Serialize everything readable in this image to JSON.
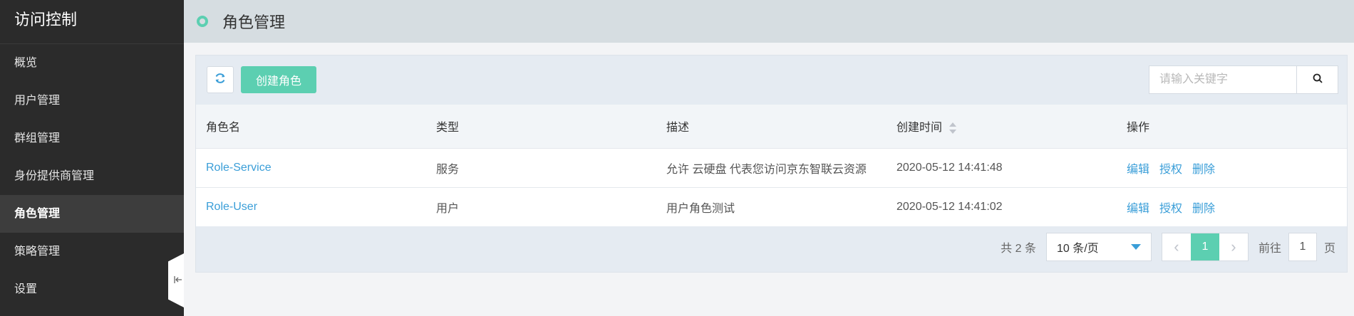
{
  "app": {
    "title": "访问控制"
  },
  "sidebar": {
    "items": [
      {
        "label": "概览"
      },
      {
        "label": "用户管理"
      },
      {
        "label": "群组管理"
      },
      {
        "label": "身份提供商管理"
      },
      {
        "label": "角色管理",
        "active": true
      },
      {
        "label": "策略管理"
      },
      {
        "label": "设置"
      }
    ],
    "collapse_icon": "collapse-left-icon"
  },
  "header": {
    "title": "角色管理",
    "accent_color": "#5ccfb1"
  },
  "toolbar": {
    "refresh_icon": "refresh-icon",
    "create_label": "创建角色",
    "search_placeholder": "请输入关键字",
    "search_value": "",
    "search_icon": "search-icon"
  },
  "table": {
    "columns": [
      "角色名",
      "类型",
      "描述",
      "创建时间",
      "操作"
    ],
    "rows": [
      {
        "name": "Role-Service",
        "type": "服务",
        "desc": "允许 云硬盘 代表您访问京东智联云资源",
        "created": "2020-05-12 14:41:48",
        "ops": [
          "编辑",
          "授权",
          "删除"
        ]
      },
      {
        "name": "Role-User",
        "type": "用户",
        "desc": "用户角色测试",
        "created": "2020-05-12 14:41:02",
        "ops": [
          "编辑",
          "授权",
          "删除"
        ]
      }
    ]
  },
  "pagination": {
    "total_text": "共 2 条",
    "page_size": "10 条/页",
    "current_page": "1",
    "goto_label": "前往",
    "goto_value": "1",
    "page_unit": "页"
  }
}
